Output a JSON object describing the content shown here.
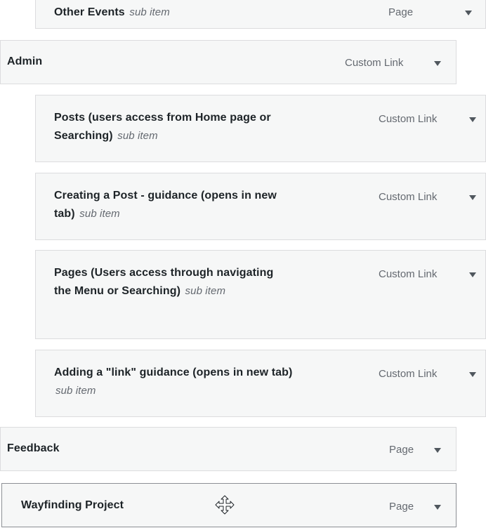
{
  "menu_items": [
    {
      "title": "Other Events",
      "sub_label": "sub item",
      "type": "Page"
    },
    {
      "title": "Admin",
      "type": "Custom Link"
    },
    {
      "title": "Posts (users access from Home page or Searching)",
      "sub_label": "sub item",
      "type": "Custom Link"
    },
    {
      "title": "Creating a Post - guidance (opens in new tab)",
      "sub_label": "sub item",
      "type": "Custom Link"
    },
    {
      "title": "Pages (Users access through navigating the Menu or Searching)",
      "sub_label": "sub item",
      "type": "Custom Link"
    },
    {
      "title": "Adding a \"link\" guidance (opens in new tab)",
      "sub_label": "sub item",
      "type": "Custom Link"
    },
    {
      "title": "Feedback",
      "type": "Page"
    },
    {
      "title": "Wayfinding Project",
      "type": "Page"
    }
  ],
  "icons": {
    "toggle": "triangle-down-icon",
    "drag": "move-cursor-icon"
  },
  "colors": {
    "item_background": "#f6f7f7",
    "item_border": "#dcdcde",
    "title_text": "#1d2327",
    "meta_text": "#646970",
    "toggle_arrow": "#50575e"
  }
}
